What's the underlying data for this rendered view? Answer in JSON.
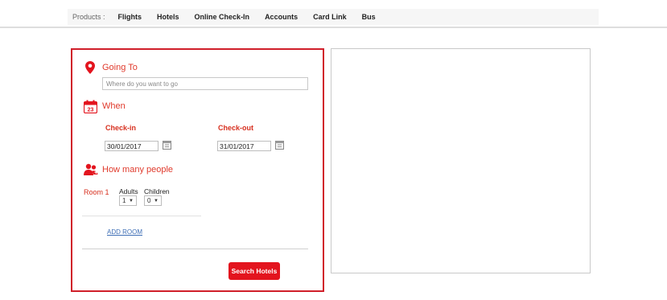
{
  "nav": {
    "products_label": "Products :",
    "links": [
      "Flights",
      "Hotels",
      "Online Check-In",
      "Accounts",
      "Card Link",
      "Bus"
    ]
  },
  "search": {
    "going_to": {
      "title": "Going To",
      "placeholder": "Where do you want to go",
      "value": ""
    },
    "when": {
      "title": "When",
      "calendar_icon_day": "23",
      "checkin_label": "Check-in",
      "checkin_value": "30/01/2017",
      "checkout_label": "Check-out",
      "checkout_value": "31/01/2017"
    },
    "people": {
      "title": "How many people",
      "room_label": "Room 1",
      "adults_label": "Adults",
      "adults_value": "1",
      "children_label": "Children",
      "children_value": "0",
      "add_room_label": "ADD ROOM"
    },
    "submit_label": "Search Hotels"
  },
  "colors": {
    "accent": "#e03a2c",
    "border": "#d01f2a",
    "button": "#e3141e",
    "link": "#3f6fb6"
  },
  "icons": [
    "location-pin-icon",
    "calendar-icon",
    "people-icon",
    "calendar-picker-icon"
  ]
}
